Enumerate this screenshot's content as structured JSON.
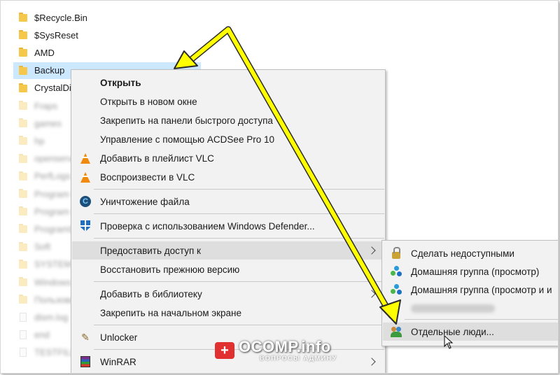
{
  "explorer": {
    "items": [
      {
        "name": "$Recycle.Bin",
        "type": "folder",
        "blurred": false,
        "selected": false
      },
      {
        "name": "$SysReset",
        "type": "folder",
        "blurred": false,
        "selected": false
      },
      {
        "name": "AMD",
        "type": "folder",
        "blurred": false,
        "selected": false
      },
      {
        "name": "Backup",
        "type": "folder",
        "blurred": false,
        "selected": true
      },
      {
        "name": "CrystalDi",
        "type": "folder",
        "blurred": false,
        "selected": false
      },
      {
        "name": "Fraps",
        "type": "folder",
        "blurred": true,
        "selected": false
      },
      {
        "name": "games",
        "type": "folder",
        "blurred": true,
        "selected": false
      },
      {
        "name": "hp",
        "type": "folder",
        "blurred": true,
        "selected": false
      },
      {
        "name": "openserver",
        "type": "folder",
        "blurred": true,
        "selected": false
      },
      {
        "name": "PerfLogs",
        "type": "folder",
        "blurred": true,
        "selected": false
      },
      {
        "name": "Program Files",
        "type": "folder",
        "blurred": true,
        "selected": false
      },
      {
        "name": "Program Files (x86)",
        "type": "folder",
        "blurred": true,
        "selected": false
      },
      {
        "name": "ProgramData",
        "type": "folder",
        "blurred": true,
        "selected": false
      },
      {
        "name": "Soft",
        "type": "folder",
        "blurred": true,
        "selected": false
      },
      {
        "name": "SYSTEM.SAV",
        "type": "folder",
        "blurred": true,
        "selected": false
      },
      {
        "name": "Windows",
        "type": "folder",
        "blurred": true,
        "selected": false
      },
      {
        "name": "Пользователи",
        "type": "folder",
        "blurred": true,
        "selected": false
      },
      {
        "name": "dism.log",
        "type": "file",
        "blurred": true,
        "selected": false
      },
      {
        "name": "end",
        "type": "file",
        "blurred": true,
        "selected": false
      },
      {
        "name": "TESTFILE",
        "type": "file",
        "blurred": true,
        "selected": false
      }
    ]
  },
  "context_menu": {
    "open": "Открыть",
    "open_new_window": "Открыть в новом окне",
    "pin_quick_access": "Закрепить на панели быстрого доступа",
    "manage_acdsee": "Управление с помощью ACDSee Pro 10",
    "vlc_add_playlist": "Добавить в плейлист VLC",
    "vlc_play": "Воспроизвести в VLC",
    "destroy_file": "Уничтожение файла",
    "defender_scan": "Проверка с использованием Windows Defender...",
    "give_access": "Предоставить доступ к",
    "restore_version": "Восстановить прежнюю версию",
    "add_library": "Добавить в библиотеку",
    "pin_start": "Закрепить на начальном экране",
    "unlocker": "Unlocker",
    "winrar": "WinRAR"
  },
  "submenu": {
    "make_private": "Сделать недоступными",
    "homegroup_view": "Домашняя группа (просмотр)",
    "homegroup_view_edit": "Домашняя группа (просмотр и и",
    "specific_people": "Отдельные люди..."
  },
  "watermark": {
    "badge": "+",
    "title": "OCOMP.info",
    "subtitle": "ВОПРОСЫ АДМИНУ"
  },
  "colors": {
    "selection": "#cce8ff",
    "menu_bg": "#f2f2f2",
    "menu_highlight": "#dedede",
    "annotation_arrow": "#ffff00",
    "folder": "#f5c84c"
  },
  "icons": {
    "vlc": "vlc-cone-icon",
    "shredder": "file-shredder-icon",
    "defender": "windows-defender-shield-icon",
    "unlocker": "unlocker-wand-icon",
    "winrar": "winrar-books-icon",
    "lock": "lock-icon",
    "homegroup": "homegroup-icon",
    "people": "people-icon"
  }
}
